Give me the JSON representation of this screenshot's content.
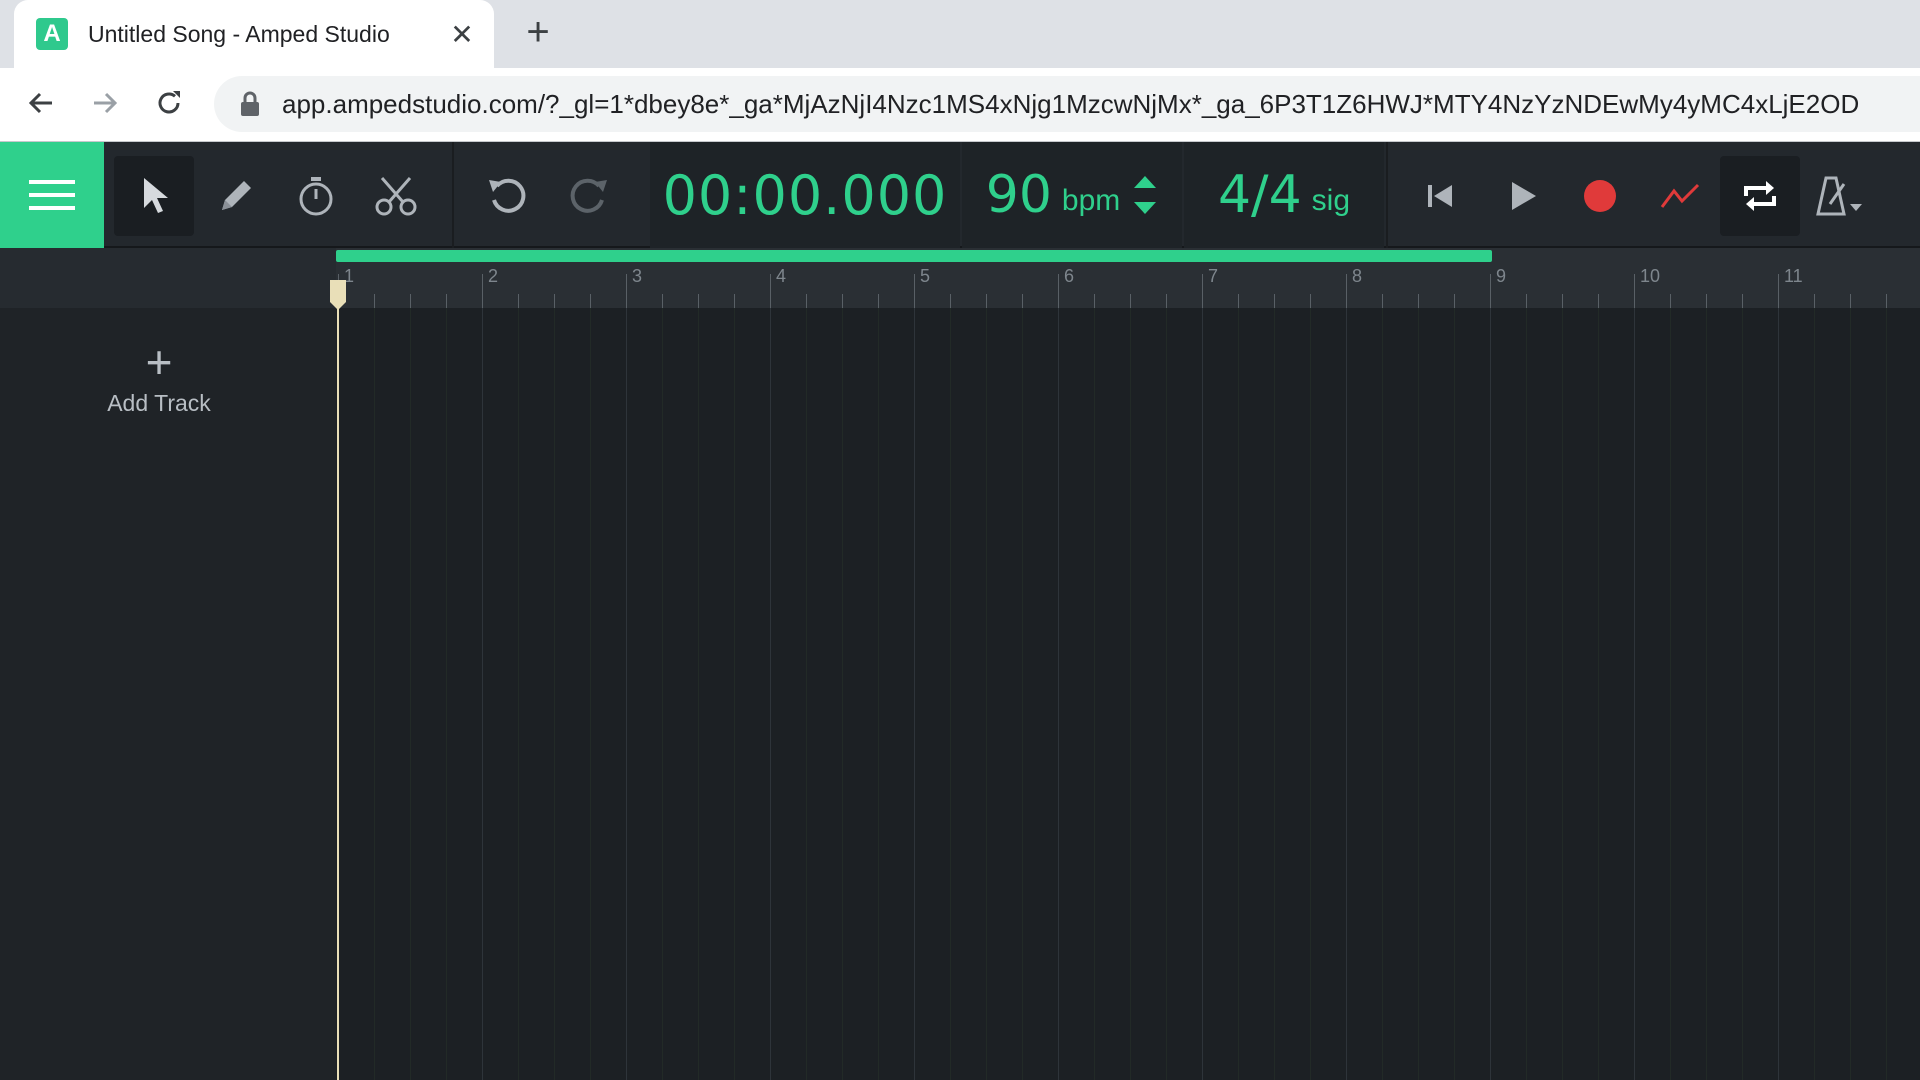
{
  "browser": {
    "tab_title": "Untitled Song - Amped Studio",
    "favicon_letter": "A",
    "url": "app.ampedstudio.com/?_gl=1*dbey8e*_ga*MjAzNjI4Nzc1MS4xNjg1MzcwNjMx*_ga_6P3T1Z6HWJ*MTY4NzYzNDEwMy4yMC4xLjE2OD"
  },
  "toolbar": {
    "time": "00:00.000",
    "bpm_value": "90",
    "bpm_unit": "bpm",
    "sig_value": "4/4",
    "sig_unit": "sig"
  },
  "ruler": {
    "bar_numbers": [
      "1",
      "2",
      "3",
      "4",
      "5",
      "6",
      "7",
      "8",
      "9",
      "10",
      "11"
    ]
  },
  "tracks": {
    "add_track_label": "Add Track"
  },
  "colors": {
    "accent": "#2fd08c",
    "record": "#e03a3a",
    "background": "#1c2024"
  },
  "icons": {
    "menu": "hamburger-icon",
    "select": "cursor-arrow-icon",
    "pencil": "pencil-icon",
    "timer": "stopwatch-icon",
    "cut": "scissors-icon",
    "undo": "undo-icon",
    "redo": "redo-icon",
    "rewind": "skip-to-start-icon",
    "play": "play-icon",
    "record": "record-icon",
    "automation": "automation-icon",
    "loop": "loop-icon",
    "metronome": "metronome-icon"
  }
}
